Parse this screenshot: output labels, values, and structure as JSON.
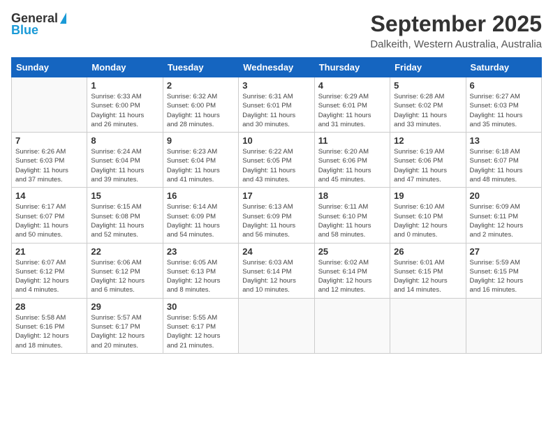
{
  "logo": {
    "line1": "General",
    "line2": "Blue"
  },
  "title": "September 2025",
  "subtitle": "Dalkeith, Western Australia, Australia",
  "days_of_week": [
    "Sunday",
    "Monday",
    "Tuesday",
    "Wednesday",
    "Thursday",
    "Friday",
    "Saturday"
  ],
  "weeks": [
    [
      {
        "day": "",
        "info": ""
      },
      {
        "day": "1",
        "info": "Sunrise: 6:33 AM\nSunset: 6:00 PM\nDaylight: 11 hours\nand 26 minutes."
      },
      {
        "day": "2",
        "info": "Sunrise: 6:32 AM\nSunset: 6:00 PM\nDaylight: 11 hours\nand 28 minutes."
      },
      {
        "day": "3",
        "info": "Sunrise: 6:31 AM\nSunset: 6:01 PM\nDaylight: 11 hours\nand 30 minutes."
      },
      {
        "day": "4",
        "info": "Sunrise: 6:29 AM\nSunset: 6:01 PM\nDaylight: 11 hours\nand 31 minutes."
      },
      {
        "day": "5",
        "info": "Sunrise: 6:28 AM\nSunset: 6:02 PM\nDaylight: 11 hours\nand 33 minutes."
      },
      {
        "day": "6",
        "info": "Sunrise: 6:27 AM\nSunset: 6:03 PM\nDaylight: 11 hours\nand 35 minutes."
      }
    ],
    [
      {
        "day": "7",
        "info": "Sunrise: 6:26 AM\nSunset: 6:03 PM\nDaylight: 11 hours\nand 37 minutes."
      },
      {
        "day": "8",
        "info": "Sunrise: 6:24 AM\nSunset: 6:04 PM\nDaylight: 11 hours\nand 39 minutes."
      },
      {
        "day": "9",
        "info": "Sunrise: 6:23 AM\nSunset: 6:04 PM\nDaylight: 11 hours\nand 41 minutes."
      },
      {
        "day": "10",
        "info": "Sunrise: 6:22 AM\nSunset: 6:05 PM\nDaylight: 11 hours\nand 43 minutes."
      },
      {
        "day": "11",
        "info": "Sunrise: 6:20 AM\nSunset: 6:06 PM\nDaylight: 11 hours\nand 45 minutes."
      },
      {
        "day": "12",
        "info": "Sunrise: 6:19 AM\nSunset: 6:06 PM\nDaylight: 11 hours\nand 47 minutes."
      },
      {
        "day": "13",
        "info": "Sunrise: 6:18 AM\nSunset: 6:07 PM\nDaylight: 11 hours\nand 48 minutes."
      }
    ],
    [
      {
        "day": "14",
        "info": "Sunrise: 6:17 AM\nSunset: 6:07 PM\nDaylight: 11 hours\nand 50 minutes."
      },
      {
        "day": "15",
        "info": "Sunrise: 6:15 AM\nSunset: 6:08 PM\nDaylight: 11 hours\nand 52 minutes."
      },
      {
        "day": "16",
        "info": "Sunrise: 6:14 AM\nSunset: 6:09 PM\nDaylight: 11 hours\nand 54 minutes."
      },
      {
        "day": "17",
        "info": "Sunrise: 6:13 AM\nSunset: 6:09 PM\nDaylight: 11 hours\nand 56 minutes."
      },
      {
        "day": "18",
        "info": "Sunrise: 6:11 AM\nSunset: 6:10 PM\nDaylight: 11 hours\nand 58 minutes."
      },
      {
        "day": "19",
        "info": "Sunrise: 6:10 AM\nSunset: 6:10 PM\nDaylight: 12 hours\nand 0 minutes."
      },
      {
        "day": "20",
        "info": "Sunrise: 6:09 AM\nSunset: 6:11 PM\nDaylight: 12 hours\nand 2 minutes."
      }
    ],
    [
      {
        "day": "21",
        "info": "Sunrise: 6:07 AM\nSunset: 6:12 PM\nDaylight: 12 hours\nand 4 minutes."
      },
      {
        "day": "22",
        "info": "Sunrise: 6:06 AM\nSunset: 6:12 PM\nDaylight: 12 hours\nand 6 minutes."
      },
      {
        "day": "23",
        "info": "Sunrise: 6:05 AM\nSunset: 6:13 PM\nDaylight: 12 hours\nand 8 minutes."
      },
      {
        "day": "24",
        "info": "Sunrise: 6:03 AM\nSunset: 6:14 PM\nDaylight: 12 hours\nand 10 minutes."
      },
      {
        "day": "25",
        "info": "Sunrise: 6:02 AM\nSunset: 6:14 PM\nDaylight: 12 hours\nand 12 minutes."
      },
      {
        "day": "26",
        "info": "Sunrise: 6:01 AM\nSunset: 6:15 PM\nDaylight: 12 hours\nand 14 minutes."
      },
      {
        "day": "27",
        "info": "Sunrise: 5:59 AM\nSunset: 6:15 PM\nDaylight: 12 hours\nand 16 minutes."
      }
    ],
    [
      {
        "day": "28",
        "info": "Sunrise: 5:58 AM\nSunset: 6:16 PM\nDaylight: 12 hours\nand 18 minutes."
      },
      {
        "day": "29",
        "info": "Sunrise: 5:57 AM\nSunset: 6:17 PM\nDaylight: 12 hours\nand 20 minutes."
      },
      {
        "day": "30",
        "info": "Sunrise: 5:55 AM\nSunset: 6:17 PM\nDaylight: 12 hours\nand 21 minutes."
      },
      {
        "day": "",
        "info": ""
      },
      {
        "day": "",
        "info": ""
      },
      {
        "day": "",
        "info": ""
      },
      {
        "day": "",
        "info": ""
      }
    ]
  ]
}
